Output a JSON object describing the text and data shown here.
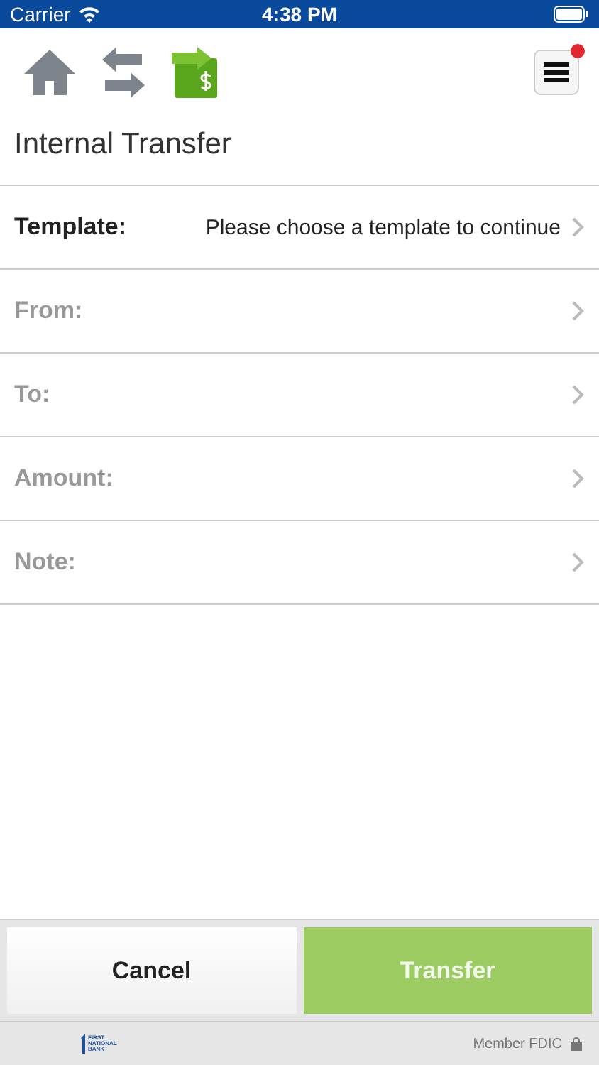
{
  "status_bar": {
    "carrier": "Carrier",
    "time": "4:38 PM"
  },
  "toolbar": {
    "menu_badge": true
  },
  "title": "Internal Transfer",
  "fields": [
    {
      "label": "Template:",
      "value": "Please choose a template to continue",
      "disabled": false
    },
    {
      "label": "From:",
      "disabled": true
    },
    {
      "label": "To:",
      "disabled": true
    },
    {
      "label": "Amount:",
      "disabled": true
    },
    {
      "label": "Note:",
      "disabled": true
    }
  ],
  "buttons": [
    {
      "label": "Cancel",
      "kind": "cancel",
      "disabled": false
    },
    {
      "label": "Transfer",
      "kind": "primary",
      "disabled": true
    }
  ],
  "footer": {
    "logo_lines": [
      "FIRST",
      "NATIONAL",
      "BANK"
    ],
    "member": "Member FDIC"
  }
}
